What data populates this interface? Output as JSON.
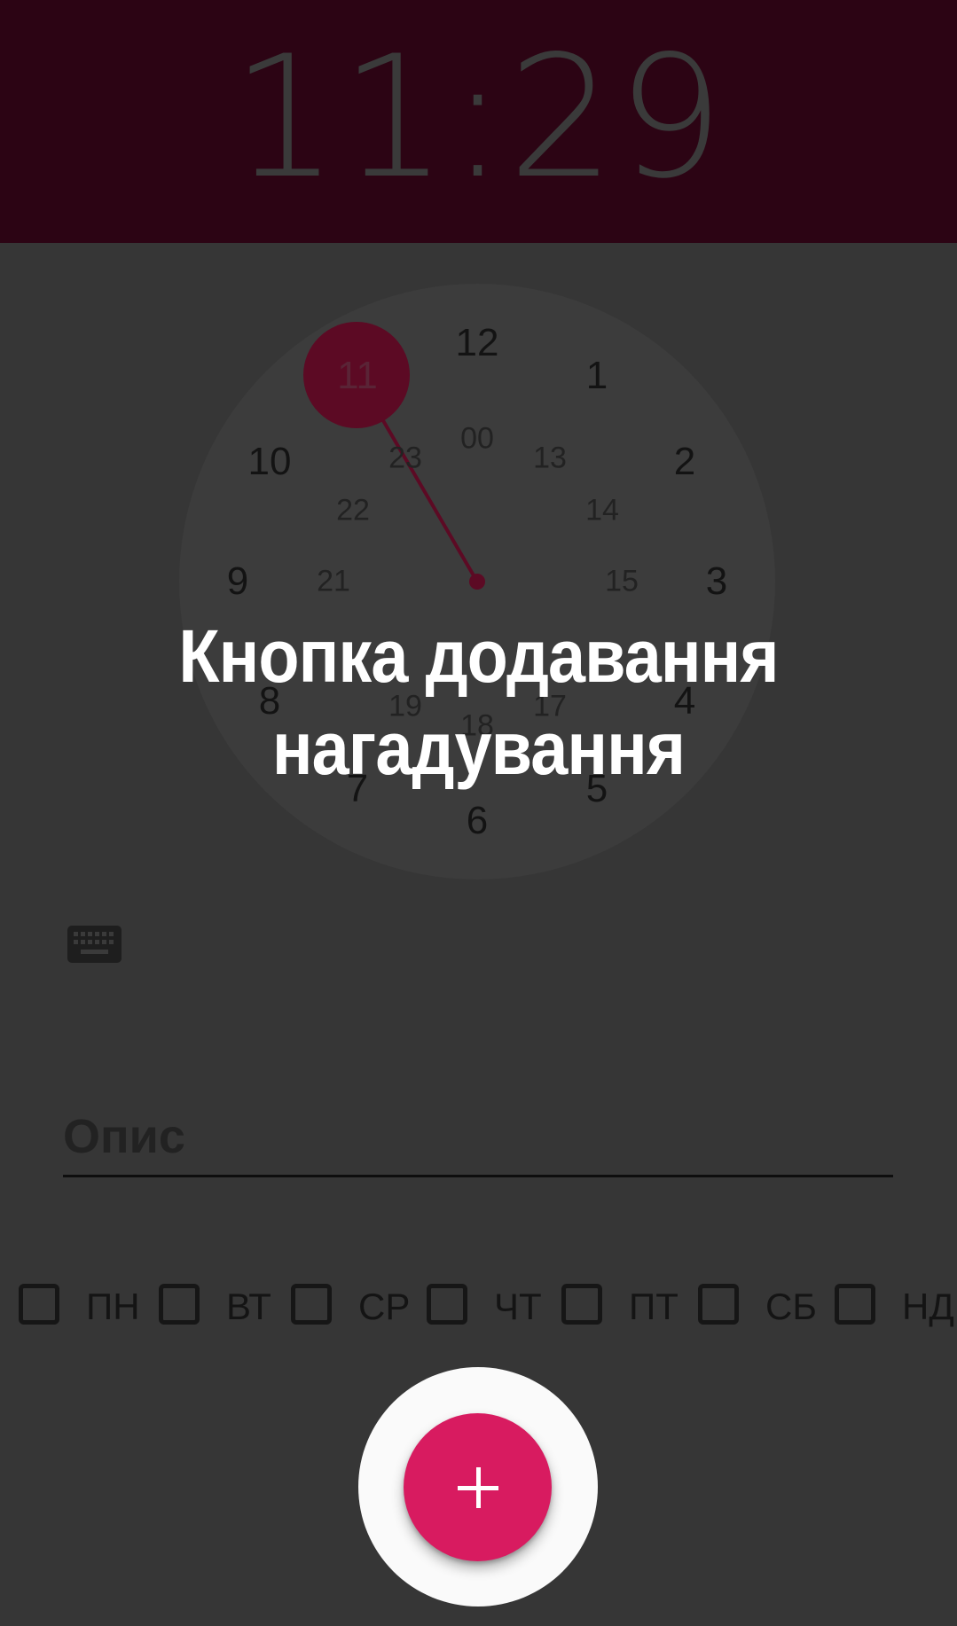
{
  "header": {
    "time": "11:29"
  },
  "clock": {
    "selected_hour": "11",
    "outer_numbers": [
      "12",
      "1",
      "2",
      "3",
      "4",
      "5",
      "6",
      "7",
      "8",
      "9",
      "10",
      "11"
    ],
    "inner_numbers": [
      "00",
      "13",
      "14",
      "15",
      "17",
      "18",
      "19",
      "21",
      "22",
      "23"
    ]
  },
  "keyboard_toggle": {
    "icon": "keyboard-icon"
  },
  "description": {
    "placeholder": "Опис",
    "value": ""
  },
  "days": [
    {
      "label": "ПН",
      "checked": false
    },
    {
      "label": "ВТ",
      "checked": false
    },
    {
      "label": "СР",
      "checked": false
    },
    {
      "label": "ЧТ",
      "checked": false
    },
    {
      "label": "ПТ",
      "checked": false
    },
    {
      "label": "СБ",
      "checked": false
    },
    {
      "label": "НД",
      "checked": false
    }
  ],
  "tooltip": {
    "line1": "Кнопка додавання",
    "line2": "нагадування"
  },
  "fab": {
    "icon": "plus-icon"
  },
  "colors": {
    "header_bg": "#2c0414",
    "accent": "#d81b60",
    "clock_hand": "#5c0a24",
    "overlay_bg": "#363636"
  }
}
